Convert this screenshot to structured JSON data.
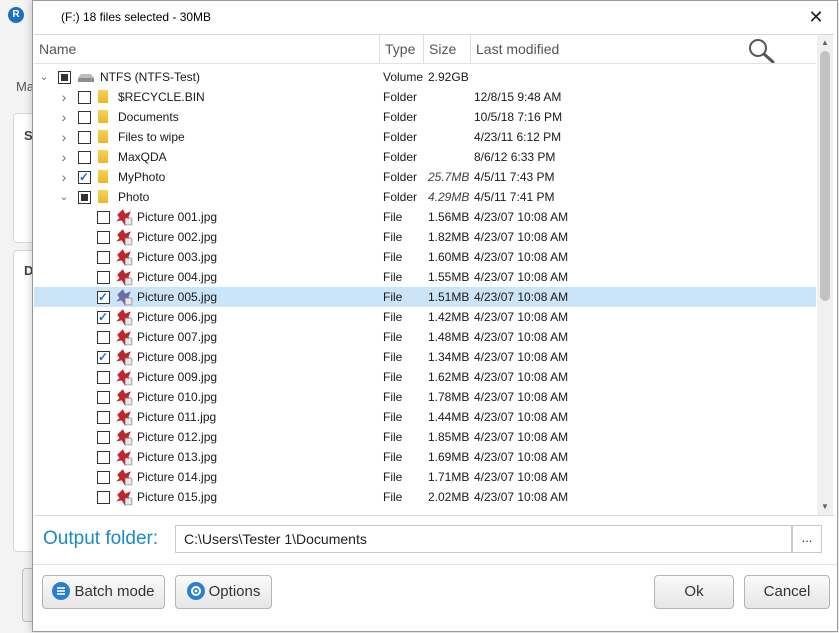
{
  "background": {
    "logo": "R",
    "tab_fragment": "Ma",
    "panel_letter_1": "S",
    "panel_letter_2": "D"
  },
  "dialog": {
    "title": "(F:) 18 files selected - 30MB",
    "close": "✕"
  },
  "columns": {
    "name": "Name",
    "type": "Type",
    "size": "Size",
    "modified": "Last modified"
  },
  "rows": [
    {
      "level": 0,
      "expander": "expanded",
      "check": "partial",
      "icon": "drive",
      "name": "NTFS (NTFS-Test)",
      "type": "Volume",
      "size": "2.92GB",
      "size_italic": false,
      "modified": ""
    },
    {
      "level": 1,
      "expander": "collapsed",
      "check": "unchecked",
      "icon": "folder",
      "name": "$RECYCLE.BIN",
      "type": "Folder",
      "size": "",
      "size_italic": false,
      "modified": "12/8/15 9:48 AM"
    },
    {
      "level": 1,
      "expander": "collapsed",
      "check": "unchecked",
      "icon": "folder",
      "name": "Documents",
      "type": "Folder",
      "size": "",
      "size_italic": false,
      "modified": "10/5/18 7:16 PM"
    },
    {
      "level": 1,
      "expander": "collapsed",
      "check": "unchecked",
      "icon": "folder",
      "name": "Files to wipe",
      "type": "Folder",
      "size": "",
      "size_italic": false,
      "modified": "4/23/11 6:12 PM"
    },
    {
      "level": 1,
      "expander": "collapsed",
      "check": "unchecked",
      "icon": "folder",
      "name": "MaxQDA",
      "type": "Folder",
      "size": "",
      "size_italic": false,
      "modified": "8/6/12 6:33 PM"
    },
    {
      "level": 1,
      "expander": "collapsed",
      "check": "checked",
      "icon": "folder",
      "name": "MyPhoto",
      "type": "Folder",
      "size": "25.7MB",
      "size_italic": true,
      "modified": "4/5/11 7:43 PM"
    },
    {
      "level": 1,
      "expander": "expanded",
      "check": "partial",
      "icon": "folder",
      "name": "Photo",
      "type": "Folder",
      "size": "4.29MB",
      "size_italic": true,
      "modified": "4/5/11 7:41 PM"
    },
    {
      "level": 2,
      "expander": "",
      "check": "unchecked",
      "icon": "image",
      "name": "Picture 001.jpg",
      "type": "File",
      "size": "1.56MB",
      "size_italic": false,
      "modified": "4/23/07 10:08 AM"
    },
    {
      "level": 2,
      "expander": "",
      "check": "unchecked",
      "icon": "image",
      "name": "Picture 002.jpg",
      "type": "File",
      "size": "1.82MB",
      "size_italic": false,
      "modified": "4/23/07 10:08 AM"
    },
    {
      "level": 2,
      "expander": "",
      "check": "unchecked",
      "icon": "image",
      "name": "Picture 003.jpg",
      "type": "File",
      "size": "1.60MB",
      "size_italic": false,
      "modified": "4/23/07 10:08 AM"
    },
    {
      "level": 2,
      "expander": "",
      "check": "unchecked",
      "icon": "image",
      "name": "Picture 004.jpg",
      "type": "File",
      "size": "1.55MB",
      "size_italic": false,
      "modified": "4/23/07 10:08 AM"
    },
    {
      "level": 2,
      "expander": "",
      "check": "checked",
      "icon": "image",
      "name": "Picture 005.jpg",
      "type": "File",
      "size": "1.51MB",
      "size_italic": false,
      "modified": "4/23/07 10:08 AM",
      "selected": true
    },
    {
      "level": 2,
      "expander": "",
      "check": "checked",
      "icon": "image",
      "name": "Picture 006.jpg",
      "type": "File",
      "size": "1.42MB",
      "size_italic": false,
      "modified": "4/23/07 10:08 AM"
    },
    {
      "level": 2,
      "expander": "",
      "check": "unchecked",
      "icon": "image",
      "name": "Picture 007.jpg",
      "type": "File",
      "size": "1.48MB",
      "size_italic": false,
      "modified": "4/23/07 10:08 AM"
    },
    {
      "level": 2,
      "expander": "",
      "check": "checked",
      "icon": "image",
      "name": "Picture 008.jpg",
      "type": "File",
      "size": "1.34MB",
      "size_italic": false,
      "modified": "4/23/07 10:08 AM"
    },
    {
      "level": 2,
      "expander": "",
      "check": "unchecked",
      "icon": "image",
      "name": "Picture 009.jpg",
      "type": "File",
      "size": "1.62MB",
      "size_italic": false,
      "modified": "4/23/07 10:08 AM"
    },
    {
      "level": 2,
      "expander": "",
      "check": "unchecked",
      "icon": "image",
      "name": "Picture 010.jpg",
      "type": "File",
      "size": "1.78MB",
      "size_italic": false,
      "modified": "4/23/07 10:08 AM"
    },
    {
      "level": 2,
      "expander": "",
      "check": "unchecked",
      "icon": "image",
      "name": "Picture 011.jpg",
      "type": "File",
      "size": "1.44MB",
      "size_italic": false,
      "modified": "4/23/07 10:08 AM"
    },
    {
      "level": 2,
      "expander": "",
      "check": "unchecked",
      "icon": "image",
      "name": "Picture 012.jpg",
      "type": "File",
      "size": "1.85MB",
      "size_italic": false,
      "modified": "4/23/07 10:08 AM"
    },
    {
      "level": 2,
      "expander": "",
      "check": "unchecked",
      "icon": "image",
      "name": "Picture 013.jpg",
      "type": "File",
      "size": "1.69MB",
      "size_italic": false,
      "modified": "4/23/07 10:08 AM"
    },
    {
      "level": 2,
      "expander": "",
      "check": "unchecked",
      "icon": "image",
      "name": "Picture 014.jpg",
      "type": "File",
      "size": "1.71MB",
      "size_italic": false,
      "modified": "4/23/07 10:08 AM"
    },
    {
      "level": 2,
      "expander": "",
      "check": "unchecked",
      "icon": "image",
      "name": "Picture 015.jpg",
      "type": "File",
      "size": "2.02MB",
      "size_italic": false,
      "modified": "4/23/07 10:08 AM"
    }
  ],
  "output": {
    "label": "Output folder:",
    "value": "C:\\Users\\Tester 1\\Documents",
    "browse": "..."
  },
  "buttons": {
    "batch": "Batch mode",
    "options": "Options",
    "ok": "Ok",
    "cancel": "Cancel"
  },
  "colors": {
    "accent": "#1a8bc4",
    "selection": "#cce4f7",
    "folder": "#f2c94c",
    "image_icon": "#c0262d"
  },
  "icons": {
    "search": "magnifier-icon",
    "drive": "drive-icon",
    "folder": "folder-icon",
    "image": "image-file-icon",
    "batch": "list-icon",
    "options": "gear-icon"
  }
}
